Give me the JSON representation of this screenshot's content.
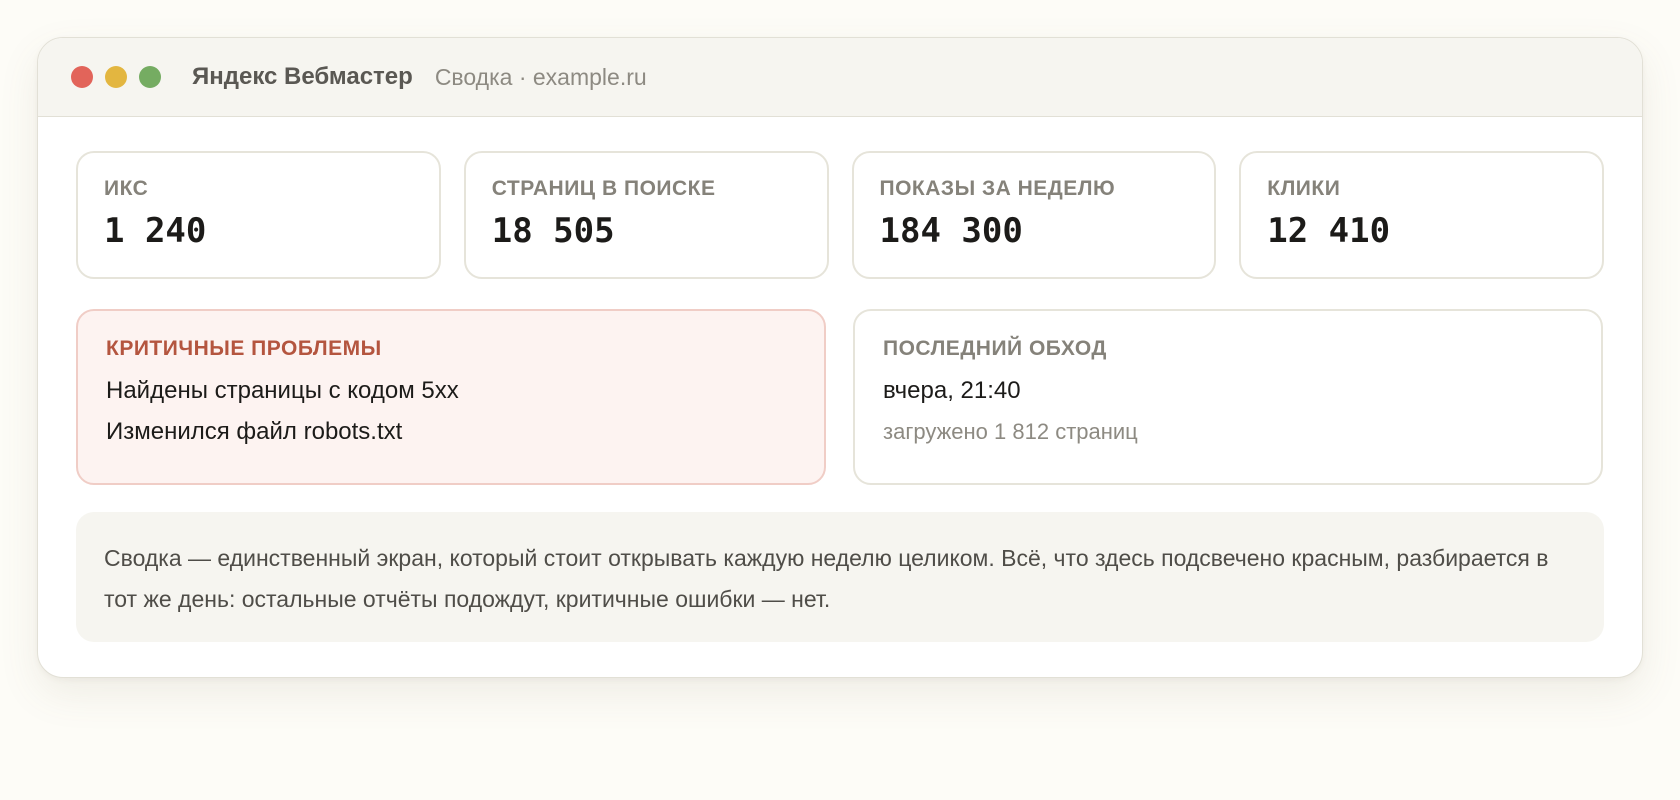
{
  "window": {
    "app_title": "Яндекс Вебмастер",
    "page_subtitle": "Сводка · example.ru"
  },
  "stats": [
    {
      "label": "ИКС",
      "value": "1 240"
    },
    {
      "label": "СТРАНИЦ В ПОИСКЕ",
      "value": "18 505"
    },
    {
      "label": "ПОКАЗЫ ЗА НЕДЕЛЮ",
      "value": "184 300"
    },
    {
      "label": "КЛИКИ",
      "value": "12 410"
    }
  ],
  "critical": {
    "title": "КРИТИЧНЫЕ ПРОБЛЕМЫ",
    "items": [
      "Найдены страницы с кодом 5xx",
      "Изменился файл robots.txt"
    ]
  },
  "crawl": {
    "title": "ПОСЛЕДНИЙ ОБХОД",
    "time": "вчера, 21:40",
    "note": "загружено 1 812 страниц"
  },
  "summary_note": "Сводка — единственный экран, который стоит открывать каждую неделю целиком. Всё, что здесь подсвечено красным, разбирается в тот же день: остальные отчёты подождут, критичные ошибки — нет.",
  "colors": {
    "close": "#e2645a",
    "minimize": "#e3b640",
    "maximize": "#75ac62",
    "critical_accent": "#b4553f"
  }
}
